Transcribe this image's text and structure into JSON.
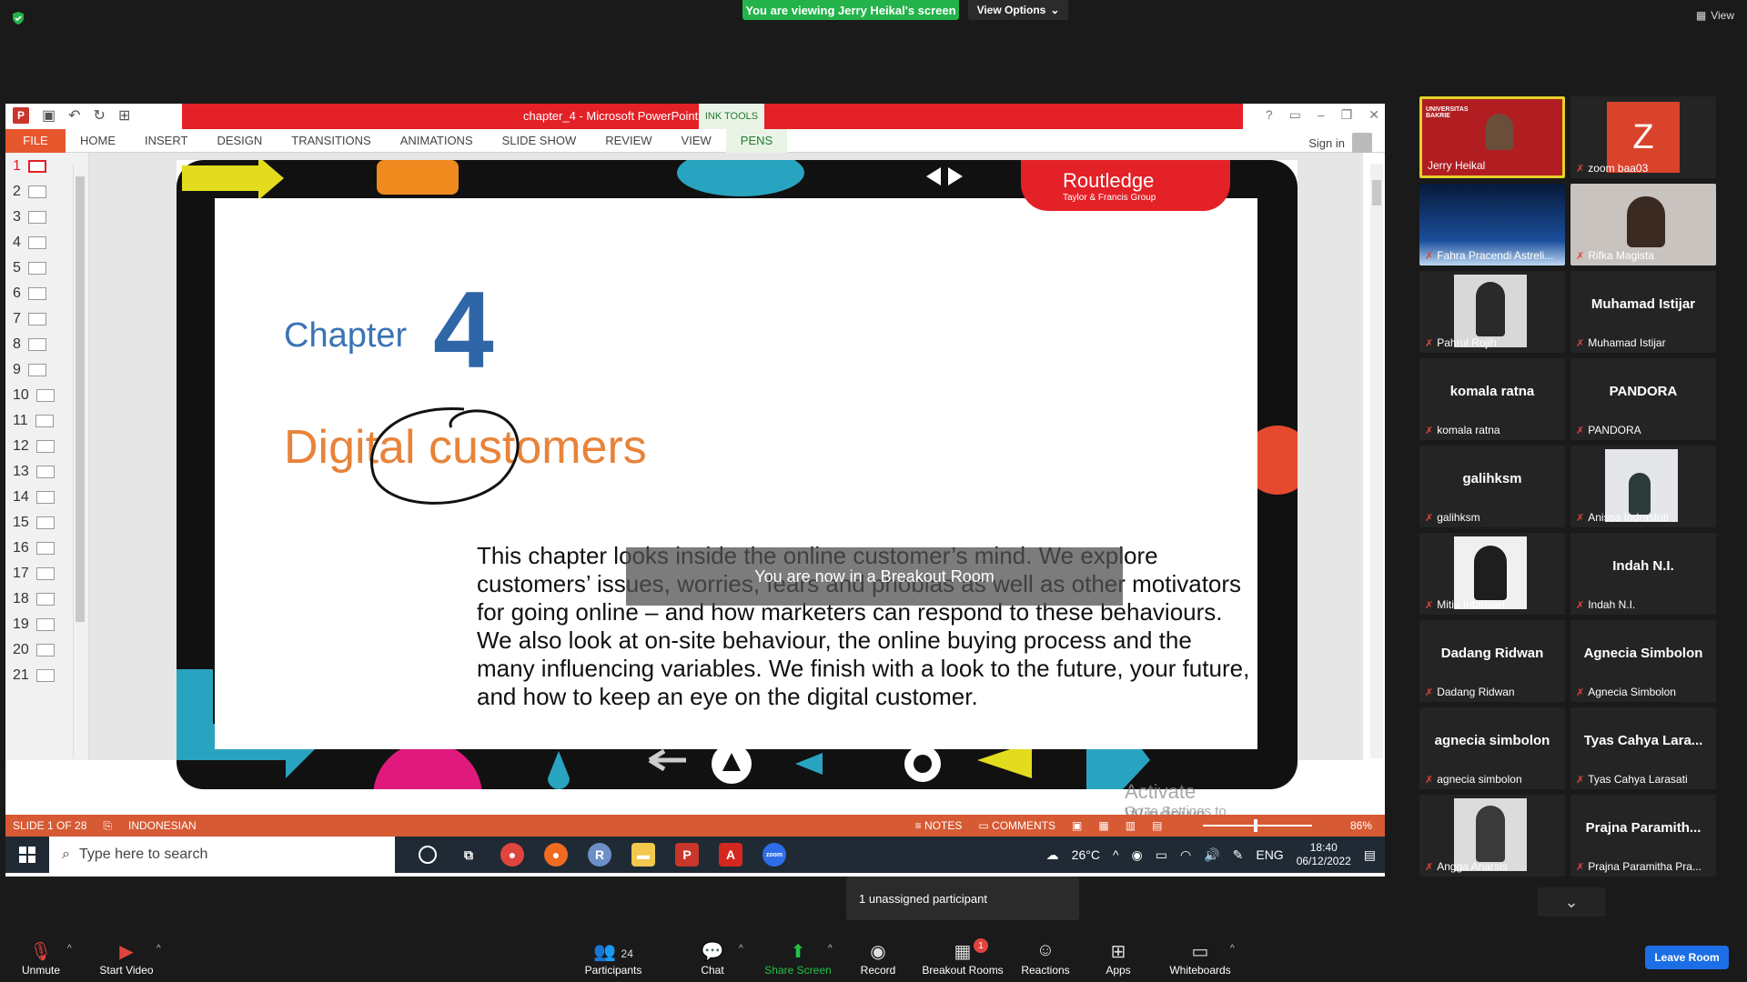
{
  "zoom_top": {
    "viewing_banner": "You are viewing Jerry Heikal's screen",
    "view_options": "View Options",
    "view_label": "View"
  },
  "ppt": {
    "title": "chapter_4 -  Microsoft PowerPoint",
    "ink_tools": "INK TOOLS",
    "tabs": [
      "FILE",
      "HOME",
      "INSERT",
      "DESIGN",
      "TRANSITIONS",
      "ANIMATIONS",
      "SLIDE SHOW",
      "REVIEW",
      "VIEW",
      "PENS"
    ],
    "sign_in": "Sign in",
    "slide_numbers": [
      "1",
      "2",
      "3",
      "4",
      "5",
      "6",
      "7",
      "8",
      "9",
      "10",
      "11",
      "12",
      "13",
      "14",
      "15",
      "16",
      "17",
      "18",
      "19",
      "20",
      "21"
    ],
    "status": {
      "slide_of": "SLIDE 1 OF 28",
      "language": "INDONESIAN",
      "notes": "NOTES",
      "comments": "COMMENTS",
      "zoom": "86%"
    }
  },
  "slide": {
    "chapter_word": "Chapter",
    "chapter_number": "4",
    "title": "Digital customers",
    "body": "This chapter looks inside the online customer’s mind. We explore customers’ issues, worries, fears and phobias as well as other motivators for going online – and how marketers can respond to these behaviours. We also look at on-site behaviour, the online buying process and the many influencing variables. We finish with a look to the future, your future, and how to keep an eye on the digital customer.",
    "publisher": "Routledge",
    "publisher_sub": "Taylor & Francis Group",
    "watermark_line1": "Activate Windows",
    "watermark_line2": "Go to Settings to activate Windows."
  },
  "breakout_toast": "You are now in a Breakout Room",
  "taskbar": {
    "search_placeholder": "Type here to search",
    "temperature": "26°C",
    "lang": "ENG",
    "time": "18:40",
    "date": "06/12/2022"
  },
  "participants": [
    {
      "name": "Jerry Heikal",
      "display": "",
      "type": "video"
    },
    {
      "name": "zoom baa03",
      "display": "Z",
      "type": "avatar"
    },
    {
      "name": "Fahra Pracendi Astreli...",
      "display": "",
      "type": "video"
    },
    {
      "name": "Rifka Magista",
      "display": "",
      "type": "video"
    },
    {
      "name": "Pahrul Rojih",
      "display": "",
      "type": "photo"
    },
    {
      "name": "Muhamad Istijar",
      "display": "Muhamad Istijar",
      "type": "text"
    },
    {
      "name": "komala ratna",
      "display": "komala ratna",
      "type": "text"
    },
    {
      "name": "PANDORA",
      "display": "PANDORA",
      "type": "text"
    },
    {
      "name": "galihksm",
      "display": "galihksm",
      "type": "text"
    },
    {
      "name": "Anissa Indrastuti",
      "display": "",
      "type": "photo"
    },
    {
      "name": "Mitia Intansari",
      "display": "",
      "type": "photo"
    },
    {
      "name": "Indah N.I.",
      "display": "Indah N.I.",
      "type": "text"
    },
    {
      "name": "Dadang Ridwan",
      "display": "Dadang Ridwan",
      "type": "text"
    },
    {
      "name": "Agnecia Simbolon",
      "display": "Agnecia Simbolon",
      "type": "text"
    },
    {
      "name": "agnecia simbolon",
      "display": "agnecia simbolon",
      "type": "text"
    },
    {
      "name": "Tyas Cahya Larasati",
      "display": "Tyas Cahya Lara...",
      "type": "text"
    },
    {
      "name": "Angga Anarsis",
      "display": "",
      "type": "photo"
    },
    {
      "name": "Prajna Paramitha Pra...",
      "display": "Prajna  Paramith...",
      "type": "text"
    }
  ],
  "unassigned": "1 unassigned participant",
  "controls": {
    "unmute": "Unmute",
    "start_video": "Start Video",
    "participants": "Participants",
    "participants_count": "24",
    "chat": "Chat",
    "share_screen": "Share Screen",
    "record": "Record",
    "breakout_rooms": "Breakout Rooms",
    "breakout_badge": "1",
    "reactions": "Reactions",
    "apps": "Apps",
    "whiteboards": "Whiteboards",
    "leave_room": "Leave Room"
  },
  "colors": {
    "zoom_green": "#23b34a",
    "ppt_red": "#e32127",
    "ppt_status": "#d65a34",
    "leave_blue": "#1c6ee6",
    "active_speaker": "#e5d32a"
  }
}
